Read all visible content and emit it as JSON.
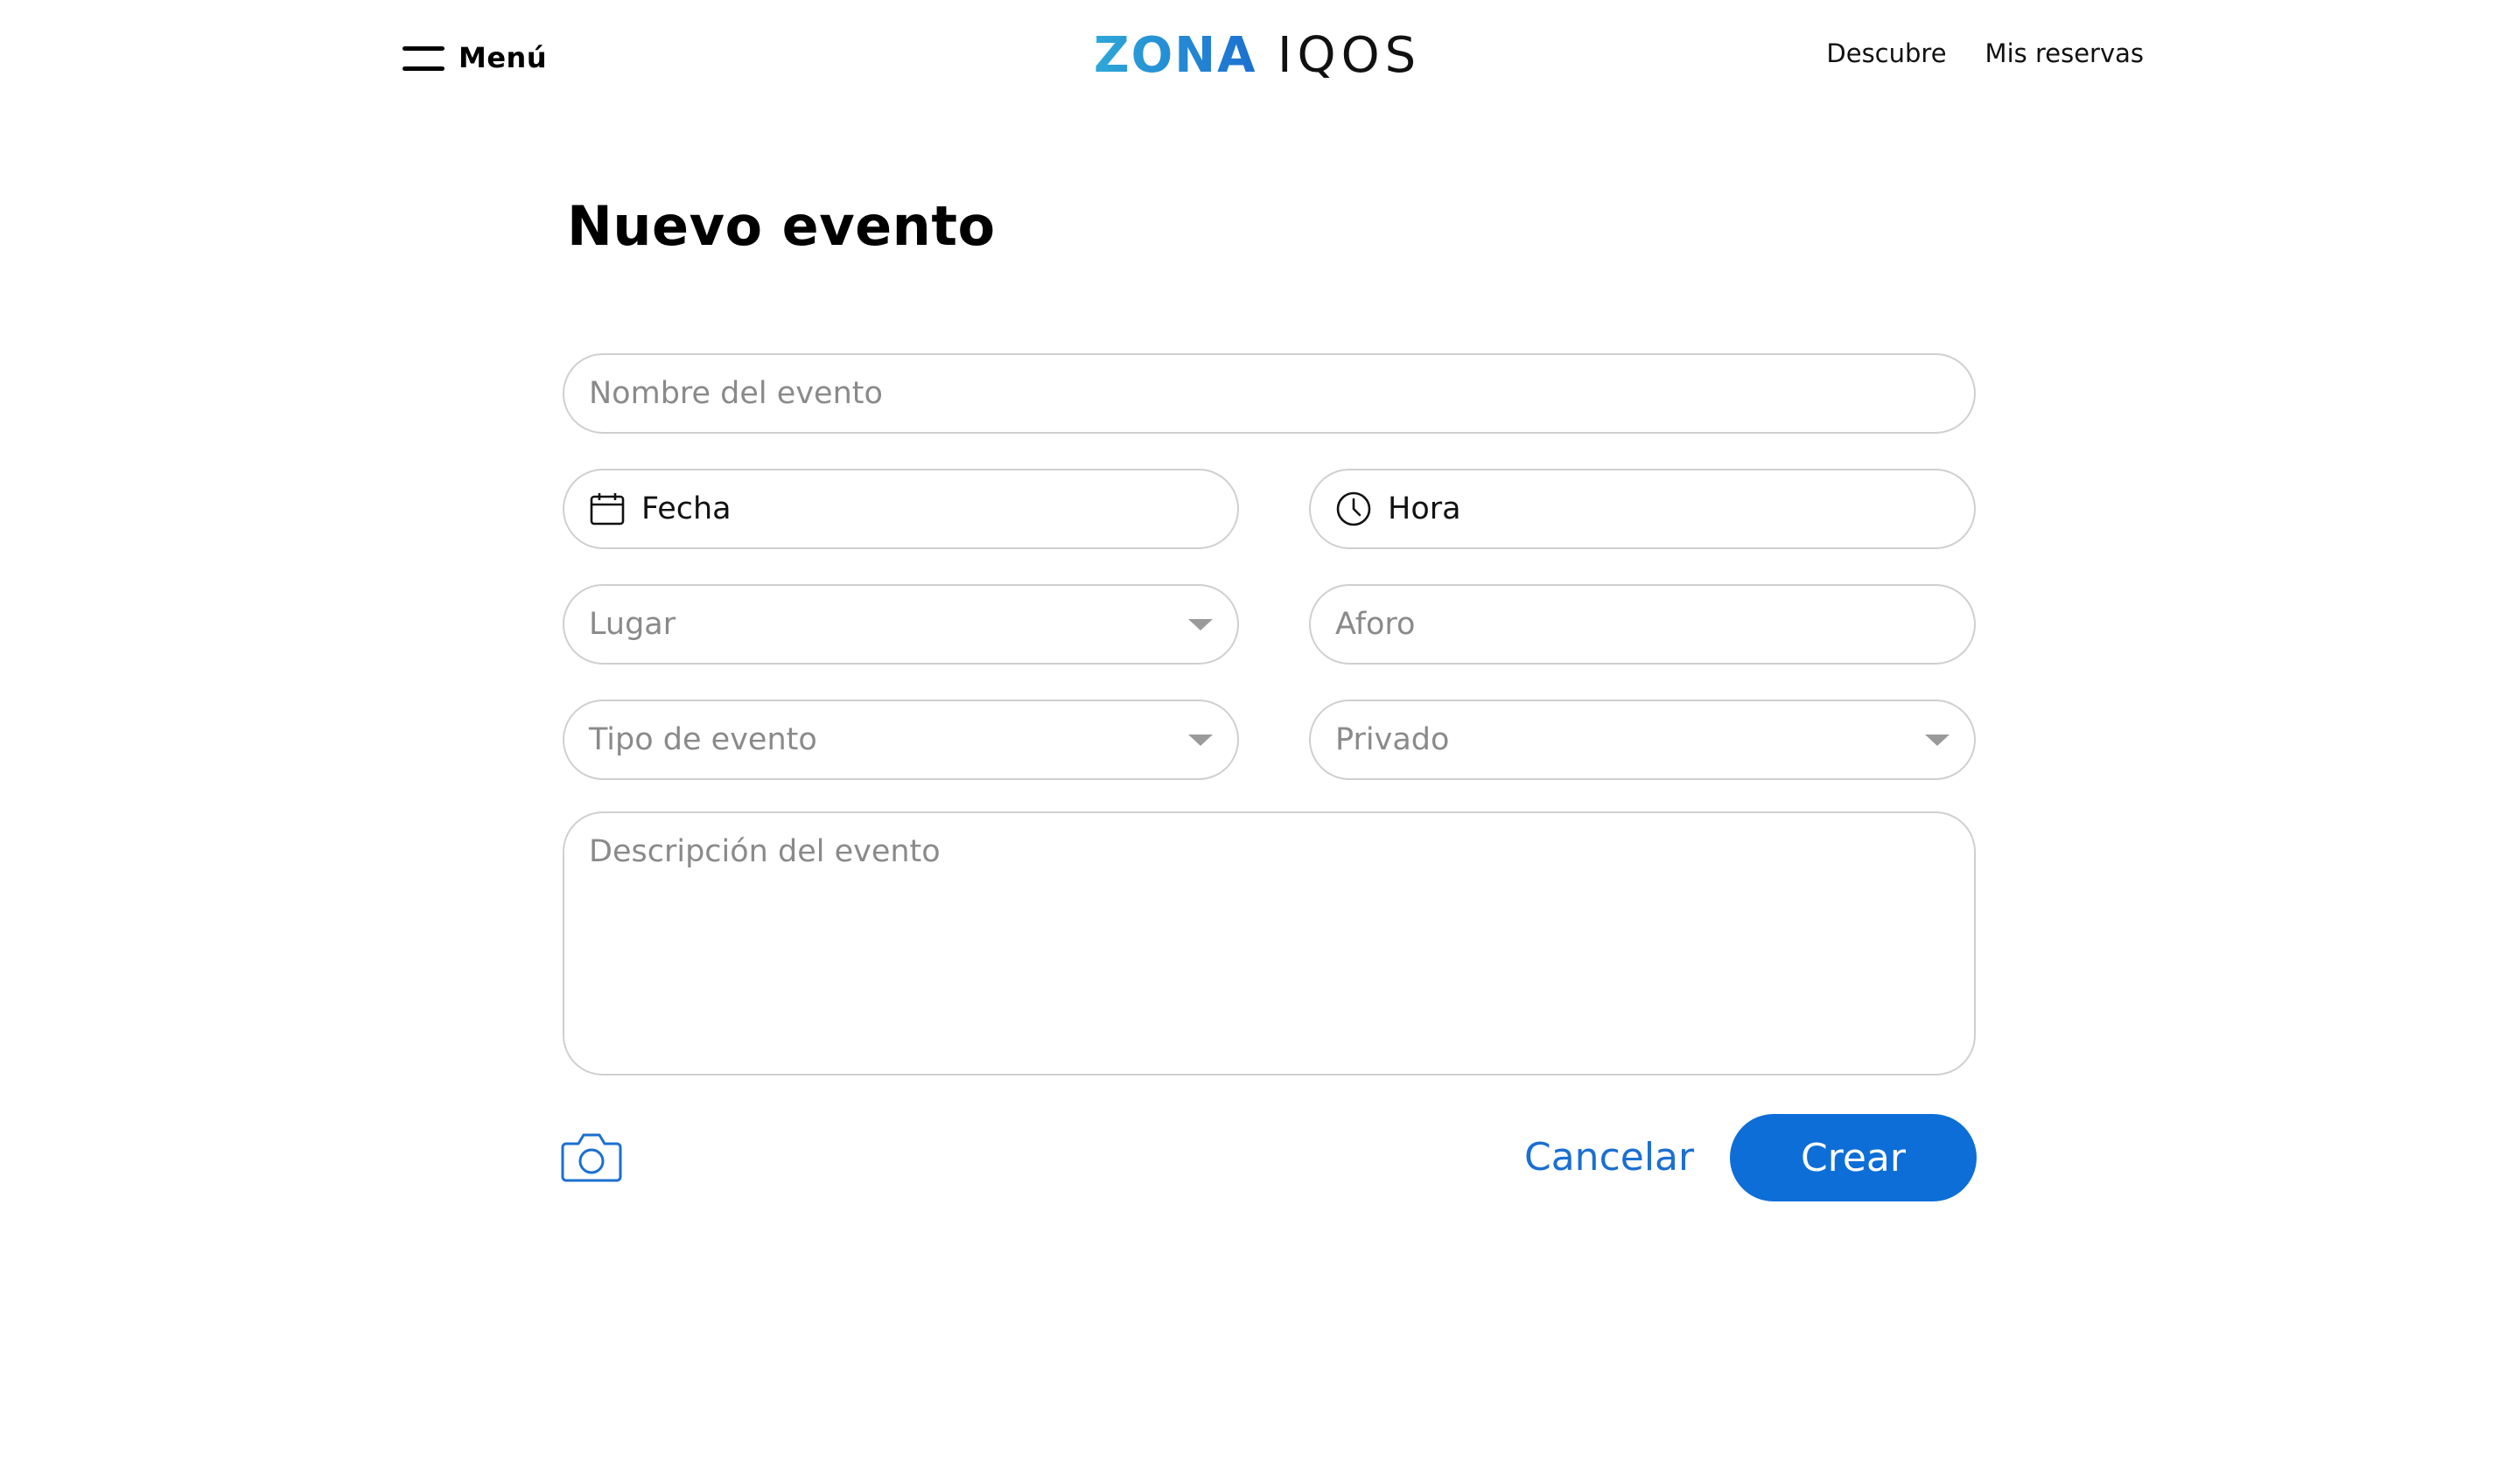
{
  "header": {
    "menu_label": "Menú",
    "logo_text_part1": "ZONA",
    "logo_text_part2": "IQOS",
    "nav": [
      "Descubre",
      "Mis reservas"
    ]
  },
  "page": {
    "title": "Nuevo evento"
  },
  "form": {
    "event_name_placeholder": "Nombre del evento",
    "date_label": "Fecha",
    "time_label": "Hora",
    "place_placeholder": "Lugar",
    "capacity_placeholder": "Aforo",
    "event_type_placeholder": "Tipo de evento",
    "privacy_placeholder": "Privado",
    "description_placeholder": "Descripción del evento"
  },
  "actions": {
    "cancel_label": "Cancelar",
    "create_label": "Crear"
  },
  "icons": {
    "menu": "hamburger-icon",
    "date": "calendar-icon",
    "time": "clock-icon",
    "dropdown": "chevron-down-icon",
    "photo": "camera-icon"
  },
  "colors": {
    "accent": "#0d6ed8",
    "link": "#1b6fd1",
    "logo_gradient_start": "#2ea8d8",
    "logo_gradient_end": "#1c6fd0",
    "border": "#cfcfcf",
    "placeholder": "#8a8a8a"
  }
}
